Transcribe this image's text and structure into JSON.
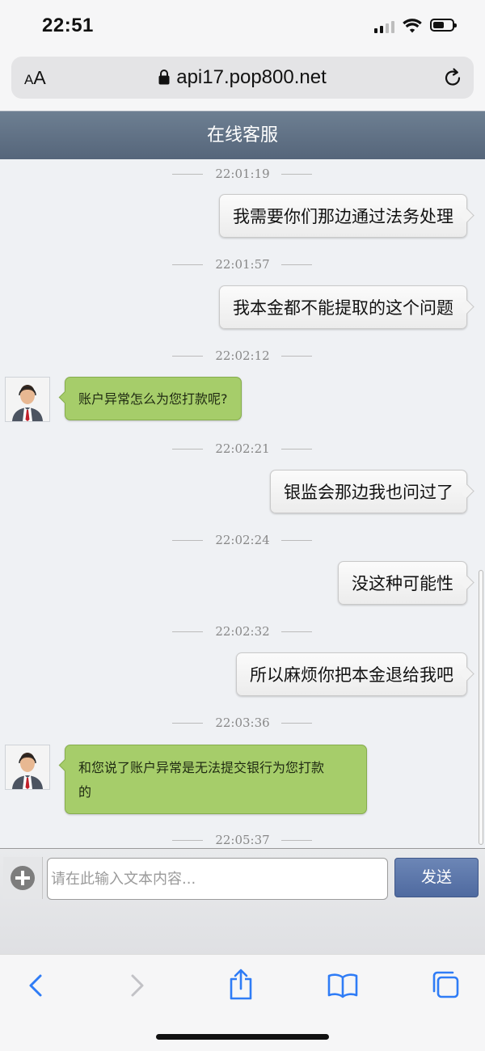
{
  "status_bar": {
    "time": "22:51"
  },
  "browser": {
    "text_size_small": "A",
    "text_size_large": "A",
    "url": "api17.pop800.net"
  },
  "header": {
    "title": "在线客服"
  },
  "messages": [
    {
      "time": "22:01:19",
      "from": "user",
      "text": "我需要你们那边通过法务处理"
    },
    {
      "time": "22:01:57",
      "from": "user",
      "text": "我本金都不能提取的这个问题"
    },
    {
      "time": "22:02:12",
      "from": "agent",
      "text": "账户异常怎么为您打款呢?"
    },
    {
      "time": "22:02:21",
      "from": "user",
      "text": "银监会那边我也问过了"
    },
    {
      "time": "22:02:24",
      "from": "user",
      "text": "没这种可能性"
    },
    {
      "time": "22:02:32",
      "from": "user",
      "text": "所以麻烦你把本金退给我吧"
    },
    {
      "time": "22:03:36",
      "from": "agent",
      "text_line1": "和您说了账户异常是无法提交银行为您打款",
      "text_line2": "的"
    },
    {
      "time": "22:05:37"
    }
  ],
  "composer": {
    "placeholder": "请在此输入文本内容...",
    "send_label": "发送"
  },
  "colors": {
    "agent_bubble": "#a6cd6a",
    "header": "#5f7085",
    "send_button": "#5d77aa",
    "ios_blue": "#2f7cf6"
  },
  "icons": [
    "back-icon",
    "forward-icon",
    "share-icon",
    "bookmarks-icon",
    "tabs-icon",
    "add-icon",
    "reload-icon",
    "lock-icon"
  ]
}
